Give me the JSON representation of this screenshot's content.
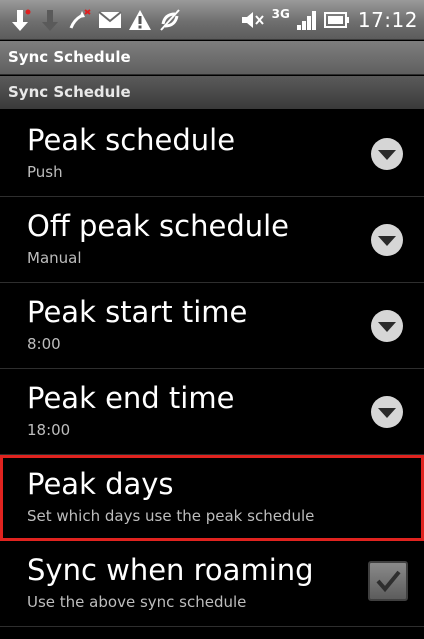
{
  "status_bar": {
    "time": "17:12",
    "network": "3G",
    "icons": [
      "usb-debug-icon",
      "download-icon",
      "missed-call-icon",
      "email-icon",
      "warning-icon",
      "sync-off-icon",
      "mute-icon",
      "signal-icon",
      "battery-icon"
    ]
  },
  "window": {
    "title": "Sync Schedule"
  },
  "section": {
    "header": "Sync Schedule"
  },
  "preferences": [
    {
      "title": "Peak schedule",
      "summary": "Push",
      "widget": "dropdown"
    },
    {
      "title": "Off peak schedule",
      "summary": "Manual",
      "widget": "dropdown"
    },
    {
      "title": "Peak start time",
      "summary": "8:00",
      "widget": "dropdown"
    },
    {
      "title": "Peak end time",
      "summary": "18:00",
      "widget": "dropdown"
    },
    {
      "title": "Peak days",
      "summary": "Set which days use the peak schedule",
      "widget": "none",
      "highlighted": true
    },
    {
      "title": "Sync when roaming",
      "summary": "Use the above sync schedule",
      "widget": "checkbox",
      "checked": true
    }
  ],
  "colors": {
    "highlight": "#e0231f",
    "background": "#000000",
    "summary_text": "#bdbdbd"
  }
}
